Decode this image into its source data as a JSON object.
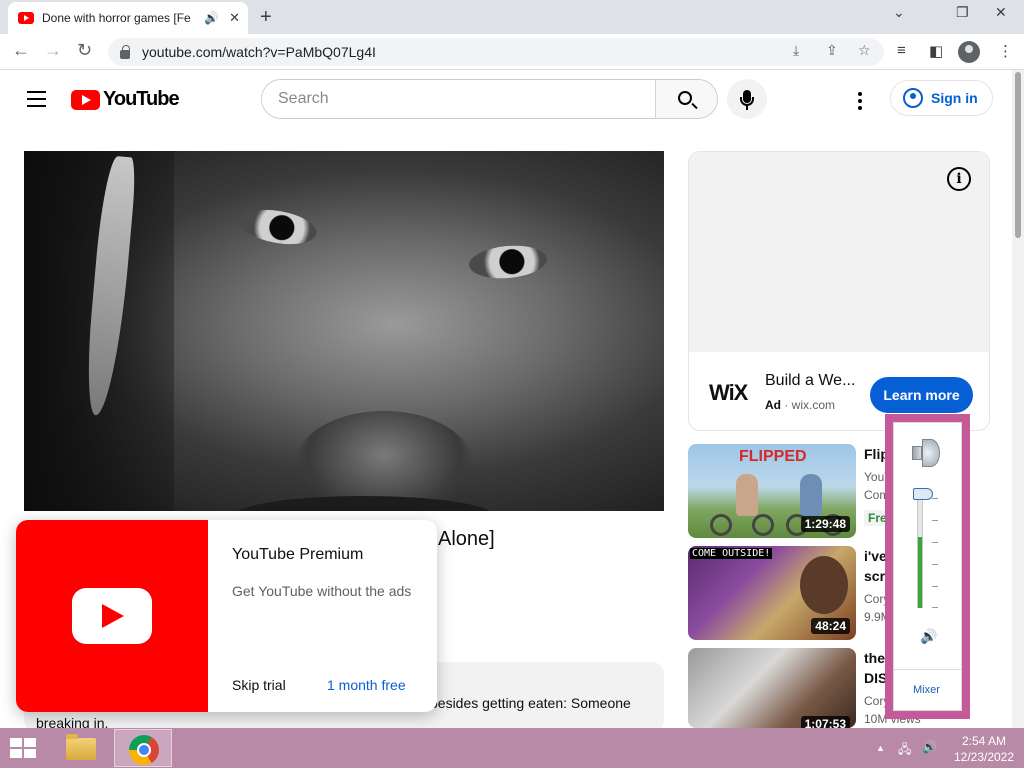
{
  "browser": {
    "tab_title": "Done with horror games [Fe",
    "new_tab": "+",
    "window_controls": {
      "minimize": "⌄",
      "restore": "❐",
      "close": "✕"
    },
    "url": "youtube.com/watch?v=PaMbQ07Lg4I"
  },
  "youtube": {
    "logo_text": "YouTube",
    "search_placeholder": "Search",
    "sign_in": "Sign in"
  },
  "ad": {
    "logo": "WiX",
    "title": "Build a We...",
    "badge": "Ad",
    "domain": "wix.com",
    "button": "Learn more",
    "info_icon": "i"
  },
  "video": {
    "title_tail": "Alone]",
    "description_1": "besides getting eaten: Someone",
    "description_2": "breaking in."
  },
  "recommendations": [
    {
      "thumb_text": "FLIPPED",
      "duration": "1:29:48",
      "title": "Flip",
      "channel": "YouT",
      "meta": "Com",
      "badge": "Fre"
    },
    {
      "thumb_text": "COME OUTSIDE!",
      "duration": "48:24",
      "title_1": "i've",
      "title_2": "scre",
      "channel": "Cory",
      "meta": "9.9M"
    },
    {
      "duration": "1:07:53",
      "title_1": "the",
      "title_2": "DIS",
      "channel": "Cory",
      "meta": "10M views"
    }
  ],
  "premium_popup": {
    "title": "YouTube Premium",
    "subtitle": "Get YouTube without the ads",
    "skip": "Skip trial",
    "offer": "1 month free"
  },
  "volume_mixer": {
    "level": 0.65,
    "mixer_label": "Mixer"
  },
  "taskbar": {
    "time": "2:54 AM",
    "date": "12/23/2022"
  }
}
